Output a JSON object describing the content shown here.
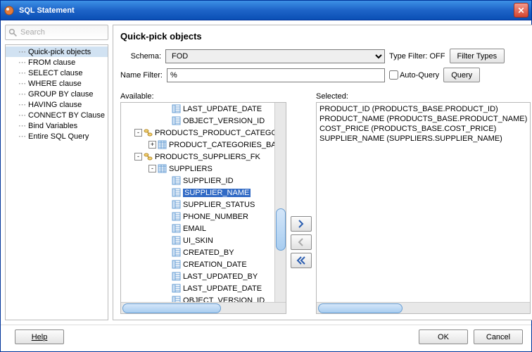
{
  "window": {
    "title": "SQL Statement"
  },
  "search": {
    "placeholder": "Search"
  },
  "nav": {
    "items": [
      "Quick-pick objects",
      "FROM clause",
      "SELECT clause",
      "WHERE clause",
      "GROUP BY clause",
      "HAVING clause",
      "CONNECT BY Clause",
      "Bind Variables",
      "Entire SQL Query"
    ],
    "selected_index": 0
  },
  "panel": {
    "title": "Quick-pick objects",
    "schema_label": "Schema:",
    "schema_value": "FOD",
    "type_filter_label": "Type Filter:",
    "type_filter_value": "OFF",
    "filter_types_btn": "Filter Types",
    "name_filter_label": "Name Filter:",
    "name_filter_value": "%",
    "auto_query_label": "Auto-Query",
    "query_btn": "Query"
  },
  "available": {
    "label": "Available:",
    "nodes": [
      {
        "indent": 70,
        "icon": "col",
        "label": "LAST_UPDATE_DATE"
      },
      {
        "indent": 70,
        "icon": "col",
        "label": "OBJECT_VERSION_ID"
      },
      {
        "indent": 30,
        "icon": "fk",
        "exp": "-",
        "label": "PRODUCTS_PRODUCT_CATEGORIES_FK"
      },
      {
        "indent": 50,
        "icon": "tbl",
        "exp": "+",
        "label": "PRODUCT_CATEGORIES_BASE"
      },
      {
        "indent": 30,
        "icon": "fk",
        "exp": "-",
        "label": "PRODUCTS_SUPPLIERS_FK"
      },
      {
        "indent": 50,
        "icon": "tbl",
        "exp": "-",
        "label": "SUPPLIERS"
      },
      {
        "indent": 70,
        "icon": "col",
        "label": "SUPPLIER_ID"
      },
      {
        "indent": 70,
        "icon": "col",
        "label": "SUPPLIER_NAME",
        "selected": true
      },
      {
        "indent": 70,
        "icon": "col",
        "label": "SUPPLIER_STATUS"
      },
      {
        "indent": 70,
        "icon": "col",
        "label": "PHONE_NUMBER"
      },
      {
        "indent": 70,
        "icon": "col",
        "label": "EMAIL"
      },
      {
        "indent": 70,
        "icon": "col",
        "label": "UI_SKIN"
      },
      {
        "indent": 70,
        "icon": "col",
        "label": "CREATED_BY"
      },
      {
        "indent": 70,
        "icon": "col",
        "label": "CREATION_DATE"
      },
      {
        "indent": 70,
        "icon": "col",
        "label": "LAST_UPDATED_BY"
      },
      {
        "indent": 70,
        "icon": "col",
        "label": "LAST_UPDATE_DATE"
      },
      {
        "indent": 70,
        "icon": "col",
        "label": "OBJECT_VERSION_ID"
      }
    ]
  },
  "selected": {
    "label": "Selected:",
    "items": [
      "PRODUCT_ID (PRODUCTS_BASE.PRODUCT_ID)",
      "PRODUCT_NAME (PRODUCTS_BASE.PRODUCT_NAME)",
      "COST_PRICE (PRODUCTS_BASE.COST_PRICE)",
      "SUPPLIER_NAME (SUPPLIERS.SUPPLIER_NAME)"
    ]
  },
  "footer": {
    "help": "Help",
    "ok": "OK",
    "cancel": "Cancel"
  }
}
